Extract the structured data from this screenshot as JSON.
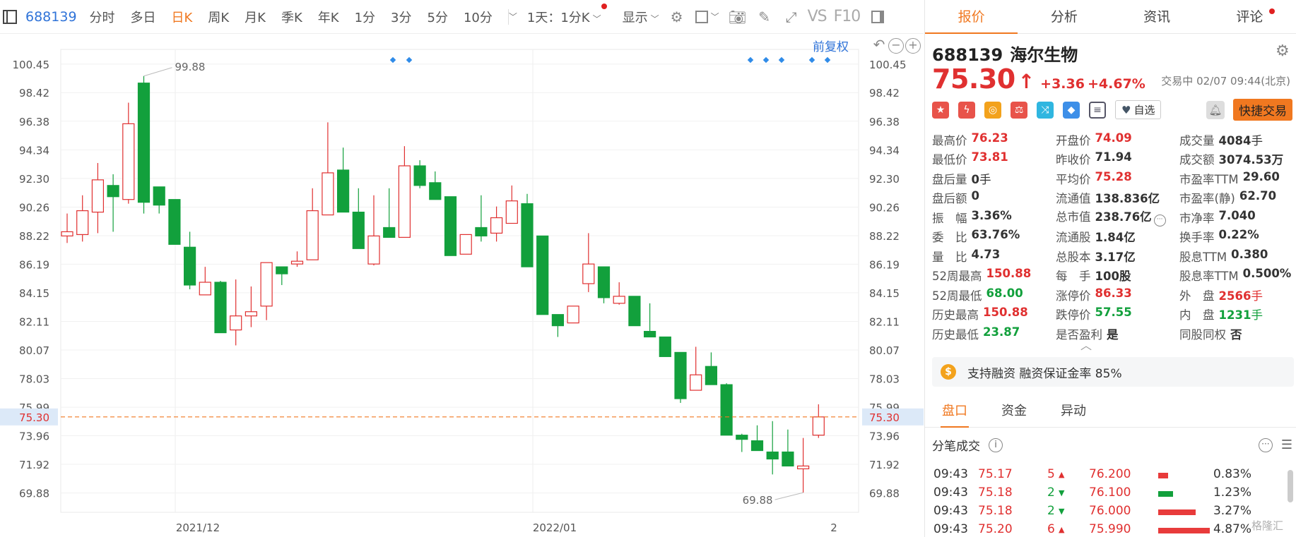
{
  "toolbar": {
    "code": "688139",
    "items": [
      {
        "label": "分时",
        "active": false
      },
      {
        "label": "多日",
        "active": false
      },
      {
        "label": "日K",
        "active": true
      },
      {
        "label": "周K",
        "active": false
      },
      {
        "label": "月K",
        "active": false
      },
      {
        "label": "季K",
        "active": false
      },
      {
        "label": "年K",
        "active": false
      },
      {
        "label": "1分",
        "active": false
      },
      {
        "label": "3分",
        "active": false
      },
      {
        "label": "5分",
        "active": false
      },
      {
        "label": "10分",
        "active": false
      }
    ],
    "period_select": "1天：1分K",
    "display_label": "显示",
    "vs_label": "VS",
    "f10_label": "F10"
  },
  "chart": {
    "adjust_label": "前复权",
    "ticks": [
      "100.45",
      "98.42",
      "96.38",
      "94.34",
      "92.30",
      "90.26",
      "88.22",
      "86.19",
      "84.15",
      "82.11",
      "80.07",
      "78.03",
      "75.99",
      "73.96",
      "71.92",
      "69.88"
    ],
    "current_price": "75.30",
    "high_label": "99.88",
    "low_label": "69.88",
    "x_labels": [
      "2021/12",
      "2022/01",
      "2"
    ]
  },
  "chart_data": {
    "type": "candlestick",
    "ylim": [
      68.5,
      101.5
    ],
    "up_color": "#e03030",
    "down_color": "#12a03c",
    "candles": [
      {
        "o": 88.2,
        "c": 88.5,
        "h": 89.8,
        "l": 87.7
      },
      {
        "o": 88.3,
        "c": 90.0,
        "h": 91.1,
        "l": 87.8
      },
      {
        "o": 89.9,
        "c": 92.2,
        "h": 93.4,
        "l": 88.4
      },
      {
        "o": 91.8,
        "c": 91.0,
        "h": 92.6,
        "l": 88.5
      },
      {
        "o": 90.8,
        "c": 96.2,
        "h": 97.7,
        "l": 90.5
      },
      {
        "o": 99.1,
        "c": 90.6,
        "h": 99.6,
        "l": 89.8
      },
      {
        "o": 91.7,
        "c": 90.4,
        "h": 91.7,
        "l": 89.8
      },
      {
        "o": 90.8,
        "c": 87.6,
        "h": 90.8,
        "l": 87.6
      },
      {
        "o": 87.4,
        "c": 84.7,
        "h": 88.5,
        "l": 84.4
      },
      {
        "o": 84.0,
        "c": 84.9,
        "h": 86.0,
        "l": 84.0
      },
      {
        "o": 84.9,
        "c": 81.3,
        "h": 85.0,
        "l": 81.3
      },
      {
        "o": 81.5,
        "c": 82.5,
        "h": 85.1,
        "l": 80.4
      },
      {
        "o": 82.5,
        "c": 82.8,
        "h": 84.6,
        "l": 81.7
      },
      {
        "o": 83.2,
        "c": 86.3,
        "h": 86.3,
        "l": 82.2
      },
      {
        "o": 86.0,
        "c": 85.5,
        "h": 86.0,
        "l": 84.7
      },
      {
        "o": 86.2,
        "c": 86.4,
        "h": 87.1,
        "l": 86.0
      },
      {
        "o": 86.5,
        "c": 90.0,
        "h": 91.6,
        "l": 86.5
      },
      {
        "o": 89.7,
        "c": 92.7,
        "h": 96.3,
        "l": 89.7
      },
      {
        "o": 92.9,
        "c": 89.9,
        "h": 94.5,
        "l": 89.9
      },
      {
        "o": 89.9,
        "c": 87.3,
        "h": 91.6,
        "l": 87.3
      },
      {
        "o": 86.2,
        "c": 88.2,
        "h": 91.1,
        "l": 86.1
      },
      {
        "o": 88.8,
        "c": 88.1,
        "h": 91.6,
        "l": 88.1
      },
      {
        "o": 88.1,
        "c": 93.2,
        "h": 94.6,
        "l": 88.1
      },
      {
        "o": 93.2,
        "c": 91.8,
        "h": 93.6,
        "l": 91.6
      },
      {
        "o": 92.0,
        "c": 90.8,
        "h": 92.8,
        "l": 90.8
      },
      {
        "o": 91.0,
        "c": 86.8,
        "h": 91.0,
        "l": 86.8
      },
      {
        "o": 86.9,
        "c": 88.3,
        "h": 88.3,
        "l": 86.9
      },
      {
        "o": 88.8,
        "c": 88.2,
        "h": 91.1,
        "l": 87.8
      },
      {
        "o": 88.4,
        "c": 89.5,
        "h": 90.3,
        "l": 87.8
      },
      {
        "o": 89.1,
        "c": 90.7,
        "h": 91.8,
        "l": 89.1
      },
      {
        "o": 90.5,
        "c": 86.0,
        "h": 91.2,
        "l": 86.0
      },
      {
        "o": 88.2,
        "c": 82.6,
        "h": 88.2,
        "l": 82.6
      },
      {
        "o": 82.6,
        "c": 81.8,
        "h": 82.6,
        "l": 81.0
      },
      {
        "o": 82.0,
        "c": 83.2,
        "h": 83.2,
        "l": 82.0
      },
      {
        "o": 84.8,
        "c": 86.2,
        "h": 88.4,
        "l": 84.2
      },
      {
        "o": 86.0,
        "c": 83.8,
        "h": 86.0,
        "l": 83.4
      },
      {
        "o": 83.4,
        "c": 83.9,
        "h": 84.9,
        "l": 83.3
      },
      {
        "o": 83.9,
        "c": 81.8,
        "h": 83.9,
        "l": 81.8
      },
      {
        "o": 81.4,
        "c": 81.0,
        "h": 83.4,
        "l": 81.0
      },
      {
        "o": 81.0,
        "c": 79.6,
        "h": 81.0,
        "l": 79.6
      },
      {
        "o": 79.9,
        "c": 76.6,
        "h": 79.9,
        "l": 76.3
      },
      {
        "o": 77.2,
        "c": 78.3,
        "h": 80.3,
        "l": 77.2
      },
      {
        "o": 78.9,
        "c": 77.6,
        "h": 79.9,
        "l": 77.6
      },
      {
        "o": 77.6,
        "c": 74.0,
        "h": 77.7,
        "l": 74.0
      },
      {
        "o": 74.0,
        "c": 73.7,
        "h": 74.1,
        "l": 72.8
      },
      {
        "o": 73.6,
        "c": 72.9,
        "h": 74.7,
        "l": 72.9
      },
      {
        "o": 72.8,
        "c": 72.3,
        "h": 75.0,
        "l": 71.2
      },
      {
        "o": 72.8,
        "c": 71.8,
        "h": 74.4,
        "l": 71.8
      },
      {
        "o": 71.6,
        "c": 71.8,
        "h": 73.8,
        "l": 69.9
      },
      {
        "o": 74.0,
        "c": 75.3,
        "h": 76.2,
        "l": 73.8
      }
    ]
  },
  "panel": {
    "tabs": [
      "报价",
      "分析",
      "资讯",
      "评论"
    ],
    "active_tab": "报价",
    "code": "688139",
    "name": "海尔生物",
    "price": "75.30",
    "change": "+3.36",
    "pct": "+4.67%",
    "trade_status": "交易中 02/07 09:44(北京)",
    "watch_label": "自选",
    "quick_label": "快捷交易",
    "icon_colors": [
      "#e8534a",
      "#e8534a",
      "#f3a21c",
      "#e8534a",
      "#2fb6e0",
      "#3d8fe8",
      "#556"
    ],
    "quote": [
      [
        {
          "l": "最高价",
          "v": "76.23",
          "c": "red"
        },
        {
          "l": "开盘价",
          "v": "74.09",
          "c": "red"
        },
        {
          "l": "成交量",
          "v": "4084",
          "u": "手",
          "c": ""
        }
      ],
      [
        {
          "l": "最低价",
          "v": "73.81",
          "c": "red"
        },
        {
          "l": "昨收价",
          "v": "71.94",
          "c": ""
        },
        {
          "l": "成交额",
          "v": "3074.53万",
          "c": ""
        }
      ],
      [
        {
          "l": "盘后量",
          "v": "0",
          "u": "手",
          "c": ""
        },
        {
          "l": "平均价",
          "v": "75.28",
          "c": "red"
        },
        {
          "l": "市盈率TTM",
          "v": "29.60",
          "c": ""
        }
      ],
      [
        {
          "l": "盘后额",
          "v": "0",
          "c": ""
        },
        {
          "l": "流通值",
          "v": "138.836亿",
          "c": ""
        },
        {
          "l": "市盈率(静)",
          "v": "62.70",
          "c": ""
        }
      ],
      [
        {
          "l": "振　幅",
          "v": "3.36%",
          "c": ""
        },
        {
          "l": "总市值",
          "v": "238.76亿",
          "c": ""
        },
        {
          "l": "市净率",
          "v": "7.040",
          "c": ""
        }
      ],
      [
        {
          "l": "委　比",
          "v": "63.76%",
          "c": ""
        },
        {
          "l": "流通股",
          "v": "1.84亿",
          "c": ""
        },
        {
          "l": "换手率",
          "v": "0.22%",
          "c": ""
        }
      ],
      [
        {
          "l": "量　比",
          "v": "4.73",
          "c": ""
        },
        {
          "l": "总股本",
          "v": "3.17亿",
          "c": ""
        },
        {
          "l": "股息TTM",
          "v": "0.380",
          "c": ""
        }
      ],
      [
        {
          "l": "52周最高",
          "v": "150.88",
          "c": "red"
        },
        {
          "l": "每　手",
          "v": "100股",
          "c": ""
        },
        {
          "l": "股息率TTM",
          "v": "0.500%",
          "c": ""
        }
      ],
      [
        {
          "l": "52周最低",
          "v": "68.00",
          "c": "green"
        },
        {
          "l": "涨停价",
          "v": "86.33",
          "c": "red"
        },
        {
          "l": "外　盘",
          "v": "2566",
          "u": "手",
          "c": "red"
        }
      ],
      [
        {
          "l": "历史最高",
          "v": "150.88",
          "c": "red"
        },
        {
          "l": "跌停价",
          "v": "57.55",
          "c": "green"
        },
        {
          "l": "内　盘",
          "v": "1231",
          "u": "手",
          "c": "green"
        }
      ],
      [
        {
          "l": "历史最低",
          "v": "23.87",
          "c": "green"
        },
        {
          "l": "是否盈利",
          "v": "是",
          "c": ""
        },
        {
          "l": "同股同权",
          "v": "否",
          "c": ""
        }
      ]
    ],
    "margin_text": "支持融资 融资保证金率 85%",
    "bottom_tabs": [
      "盘口",
      "资金",
      "异动"
    ],
    "ticks_title": "分笔成交",
    "watermark": "格隆汇",
    "trades": [
      {
        "t": "09:43",
        "p": "75.17",
        "v": "5",
        "dir": "up",
        "ob": "76.200",
        "bar": 0.12,
        "pct": "0.83%"
      },
      {
        "t": "09:43",
        "p": "75.18",
        "v": "2",
        "dir": "down",
        "ob": "76.100",
        "bar": 0.18,
        "pct": "1.23%"
      },
      {
        "t": "09:43",
        "p": "75.18",
        "v": "2",
        "dir": "down",
        "ob": "76.000",
        "bar": 0.45,
        "pct": "3.27%"
      },
      {
        "t": "09:43",
        "p": "75.20",
        "v": "6",
        "dir": "up",
        "ob": "75.990",
        "bar": 0.62,
        "pct": "4.87%"
      }
    ]
  }
}
